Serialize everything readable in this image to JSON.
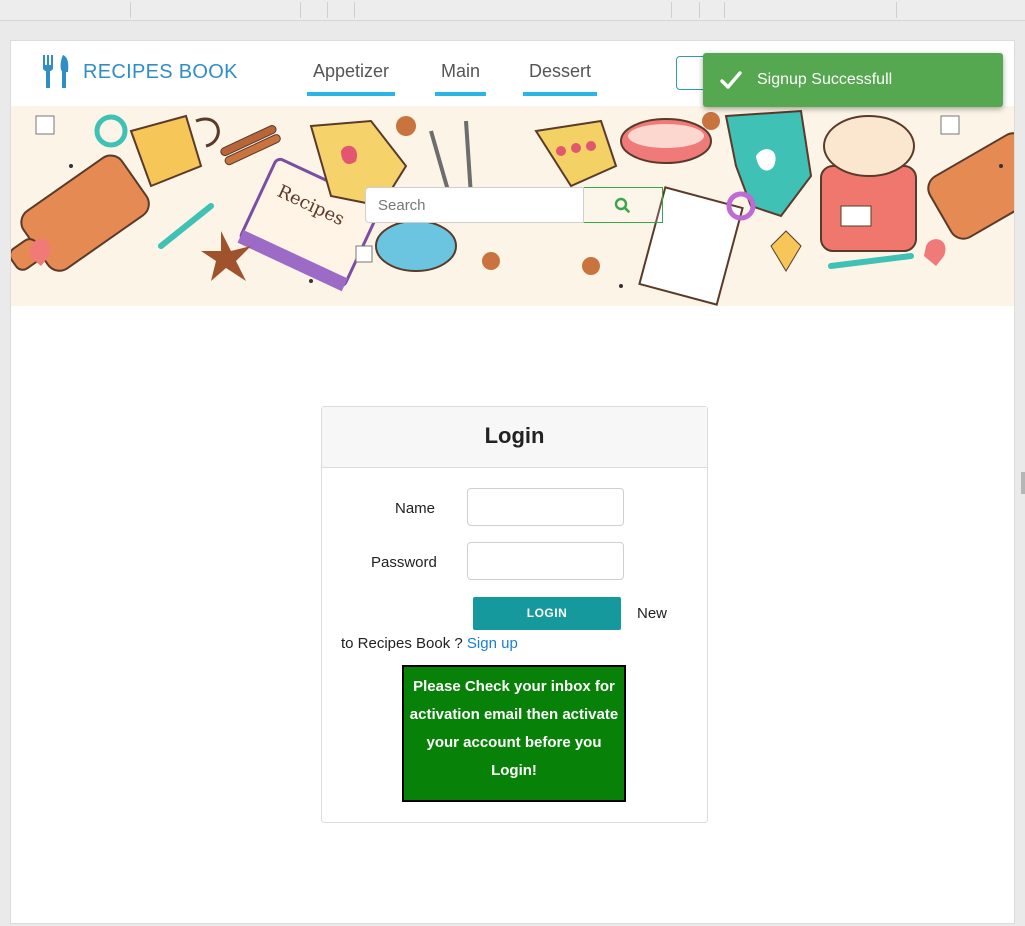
{
  "brand": {
    "name": "RECIPES BOOK",
    "logo_icon": "fork-knife-icon",
    "color": "#2f8fc5"
  },
  "nav": {
    "items": [
      {
        "label": "Appetizer"
      },
      {
        "label": "Main"
      },
      {
        "label": "Dessert"
      }
    ],
    "active_underline_color": "#29b6e5"
  },
  "toast": {
    "message": "Signup Successfull",
    "icon": "check-icon",
    "color": "#55a84f"
  },
  "search": {
    "placeholder": "Search",
    "icon": "search-icon"
  },
  "login": {
    "title": "Login",
    "name_label": "Name",
    "password_label": "Password",
    "login_button": "LOGIN",
    "new_text": "New",
    "signup_prefix": "to Recipes Book ?",
    "signup_link": "Sign up",
    "activation_notice": "Please Check your inbox for activation email then activate your account before you Login!",
    "button_color": "#16999c",
    "notice_color": "#088108"
  }
}
